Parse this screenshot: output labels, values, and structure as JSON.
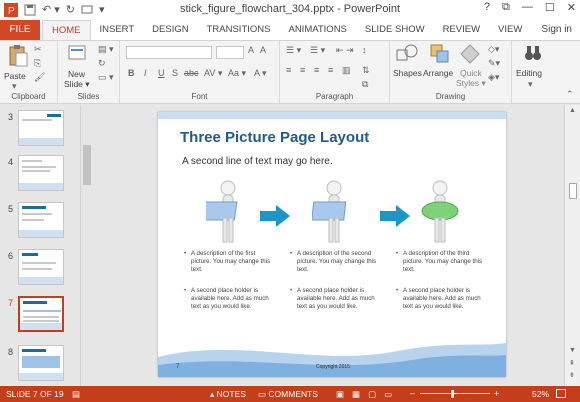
{
  "window": {
    "title": "stick_figure_flowchart_304.pptx - PowerPoint",
    "controls": [
      "?",
      "⧉",
      "—",
      "☐",
      "✕"
    ]
  },
  "tabs": {
    "file": "FILE",
    "items": [
      "HOME",
      "INSERT",
      "DESIGN",
      "TRANSITIONS",
      "ANIMATIONS",
      "SLIDE SHOW",
      "REVIEW",
      "VIEW"
    ],
    "active": "HOME",
    "signin": "Sign in"
  },
  "ribbon": {
    "clipboard": {
      "label": "Clipboard",
      "paste": "Paste"
    },
    "slides": {
      "label": "Slides",
      "new_slide": "New",
      "new_slide2": "Slide ▾"
    },
    "font": {
      "label": "Font",
      "buttons": [
        "B",
        "I",
        "U",
        "S",
        "abc",
        "AV ▾",
        "Aa ▾",
        "A ▾"
      ]
    },
    "paragraph": {
      "label": "Paragraph"
    },
    "drawing": {
      "label": "Drawing",
      "shapes": "Shapes",
      "arrange": "Arrange",
      "quick_styles": "Quick",
      "quick_styles2": "Styles ▾"
    },
    "editing": {
      "label": "Editing"
    }
  },
  "thumbnails": [
    {
      "num": "3",
      "selected": false
    },
    {
      "num": "4",
      "selected": false
    },
    {
      "num": "5",
      "selected": false
    },
    {
      "num": "6",
      "selected": false
    },
    {
      "num": "7",
      "selected": true
    },
    {
      "num": "8",
      "selected": false
    }
  ],
  "slide": {
    "title": "Three Picture Page Layout",
    "subtitle": "A second line of text may go here.",
    "columns": [
      {
        "desc1": "A description of the first picture.  You may change this text.",
        "desc2": "A second place holder is available here.  Add as much text as you would like.",
        "board_color": "#a9c9ec"
      },
      {
        "desc1": "A description of the second picture.  You may change this text.",
        "desc2": "A second place holder is available here.  Add as much text as you would like.",
        "board_color": "#a9c9ec"
      },
      {
        "desc1": "A description of the third picture.  You may change this text.",
        "desc2": "A second place holder is available here.  Add as much text as you would like.",
        "board_color": "#7ed37a"
      }
    ],
    "slide_number": "7",
    "copyright": "Copyright 2015"
  },
  "status": {
    "slide": "SLIDE 7 OF 19",
    "notes": "NOTES",
    "comments": "COMMENTS",
    "zoom_minus": "–",
    "zoom_plus": "+",
    "zoom": "52%"
  },
  "colors": {
    "accent": "#c43e1c",
    "title": "#1f5c86",
    "arrow": "#1c95c8"
  }
}
